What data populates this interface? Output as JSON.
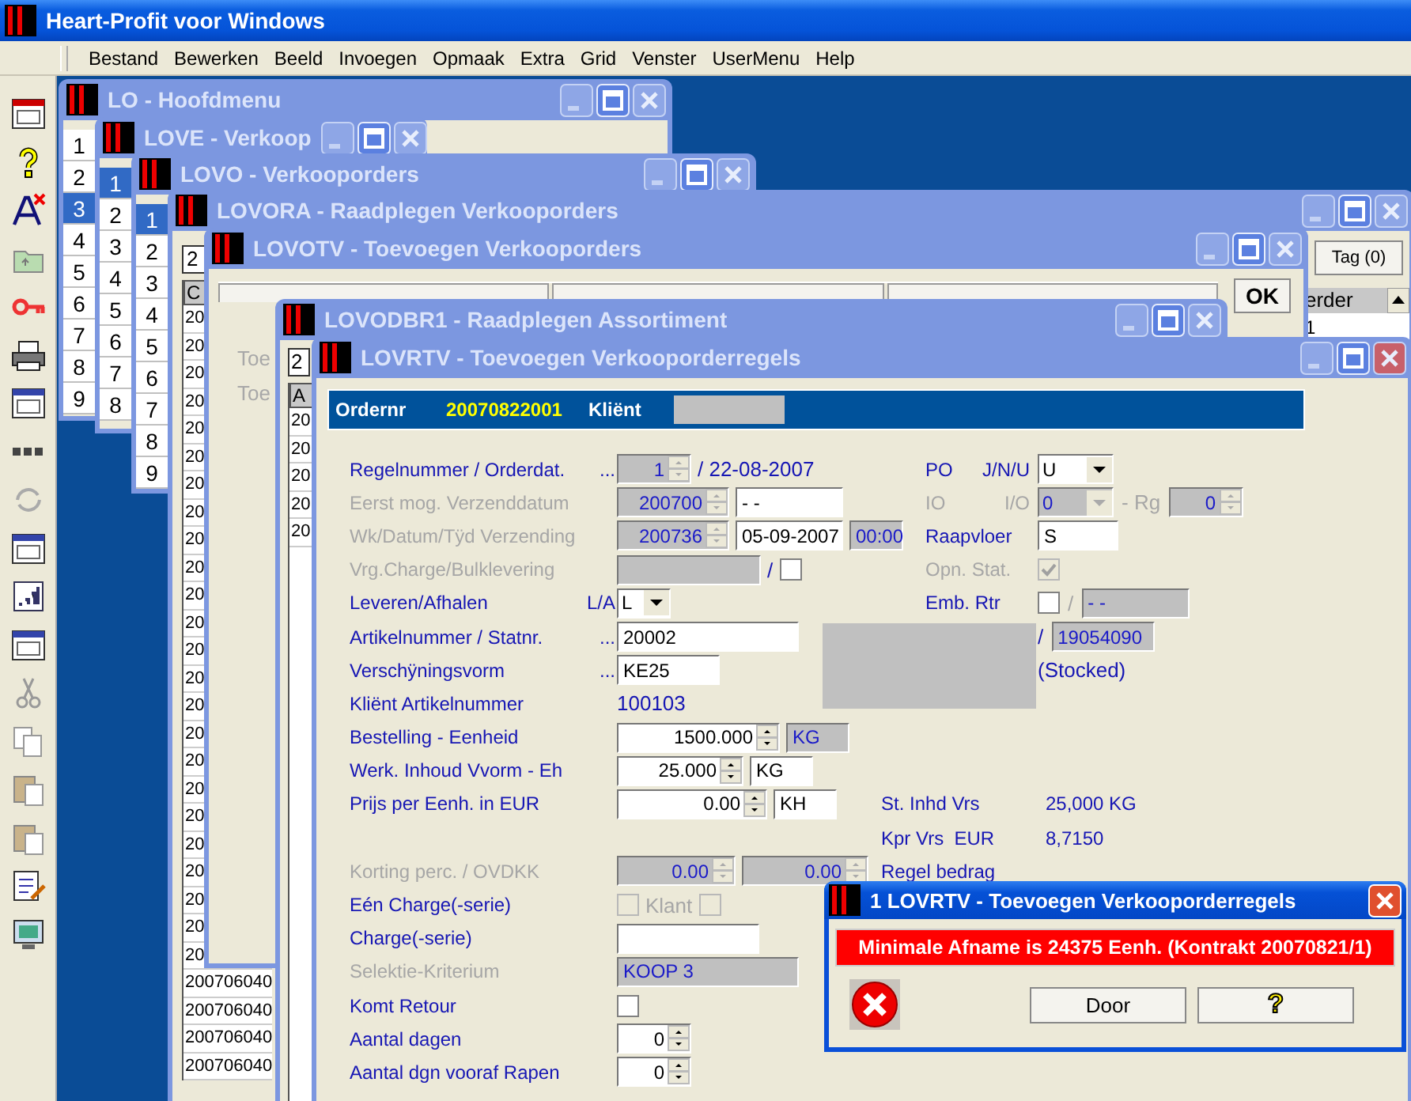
{
  "app": {
    "title": "Heart-Profit voor Windows"
  },
  "menu": [
    "Bestand",
    "Bewerken",
    "Beeld",
    "Invoegen",
    "Opmaak",
    "Extra",
    "Grid",
    "Venster",
    "UserMenu",
    "Help"
  ],
  "windows": [
    {
      "title": "LO - Hoofdmenu",
      "kind": "menu",
      "items": [
        {
          "label": "1",
          "selected": false
        },
        {
          "label": "2",
          "selected": false
        },
        {
          "label": "3",
          "selected": true
        },
        {
          "label": "4",
          "selected": false
        },
        {
          "label": "5",
          "selected": false
        },
        {
          "label": "6",
          "selected": false
        },
        {
          "label": "7",
          "selected": false
        },
        {
          "label": "8",
          "selected": false
        },
        {
          "label": "9",
          "selected": false
        }
      ]
    },
    {
      "title": "LOVE - Verkoop",
      "kind": "menu",
      "items": [
        {
          "label": "1",
          "selected": true
        },
        {
          "label": "2",
          "selected": false
        },
        {
          "label": "3",
          "selected": false
        },
        {
          "label": "4",
          "selected": false
        },
        {
          "label": "5",
          "selected": false
        },
        {
          "label": "6",
          "selected": false
        },
        {
          "label": "7",
          "selected": false
        },
        {
          "label": "8",
          "selected": false
        }
      ]
    },
    {
      "title": "LOVO - Verkooporders",
      "kind": "menu",
      "items": [
        {
          "label": "1",
          "selected": true
        },
        {
          "label": "2",
          "selected": false
        },
        {
          "label": "3",
          "selected": false
        },
        {
          "label": "4",
          "selected": false
        },
        {
          "label": "5",
          "selected": false
        },
        {
          "label": "6",
          "selected": false
        },
        {
          "label": "7",
          "selected": false
        },
        {
          "label": "8",
          "selected": false
        },
        {
          "label": "9",
          "selected": false
        }
      ]
    },
    {
      "title": "LOVORA - Raadplegen Verkooporders",
      "kind": "browse",
      "search_value": "2",
      "column_1": "C",
      "rows": [
        "20",
        "20",
        "20",
        "20",
        "20",
        "20",
        "20",
        "20",
        "20",
        "20",
        "20",
        "20",
        "20",
        "20",
        "20",
        "20",
        "20",
        "20",
        "20",
        "20",
        "20",
        "20",
        "20",
        "20",
        "200706040",
        "200706040",
        "200706040",
        "200706040"
      ],
      "tag_button": "Tag (0)",
      "column_2": "erder",
      "column_2_rows": [
        "1"
      ]
    },
    {
      "title": "LOVOTV - Toevoegen Verkooporders",
      "kind": "entry",
      "labels": [
        "Toe",
        "Toe"
      ],
      "ok_button": "OK"
    },
    {
      "title": "LOVODBR1 - Raadplegen Assortiment",
      "kind": "lookup",
      "search_value": "2",
      "column_1": "A",
      "rows": [
        "20",
        "20",
        "20",
        "20",
        "20"
      ]
    },
    {
      "title": "LOVRTV - Toevoegen Verkooporderregels",
      "kind": "form",
      "form": {
        "header": {
          "order_label": "Ordernr",
          "order_number": "20070822001",
          "client_label": "Kliënt"
        },
        "rows": [
          {
            "label": "Regelnummer / Orderdat.",
            "disabled": false,
            "prefix": "...",
            "controls": [
              {
                "kind": "spin",
                "value": "1",
                "disabled": true
              },
              {
                "kind": "plain",
                "value": "/ 22-08-2007",
                "disabled": false
              }
            ],
            "right": {
              "kind": "status",
              "label": "PO",
              "label_2": "J/N/U",
              "disabled": false,
              "controls": [
                {
                  "kind": "dropdown",
                  "value": "U",
                  "disabled": false
                }
              ]
            }
          },
          {
            "label": "Eerst mog. Verzenddatum",
            "disabled": true,
            "controls": [
              {
                "kind": "spin",
                "value": "200700",
                "disabled": true
              },
              {
                "kind": "text",
                "value": "- -"
              }
            ],
            "right": {
              "kind": "status",
              "label": "IO",
              "label_2": "I/O",
              "disabled": true,
              "controls": [
                {
                  "kind": "dropdown",
                  "value": "0",
                  "disabled": true
                },
                {
                  "kind": "plain",
                  "value": "- Rg",
                  "disabled": true
                },
                {
                  "kind": "spin",
                  "value": "0",
                  "disabled": true
                }
              ]
            }
          },
          {
            "label": "Wk/Datum/Tÿd Verzending",
            "disabled": true,
            "controls": [
              {
                "kind": "spin",
                "value": "200736",
                "disabled": true
              },
              {
                "kind": "text",
                "value": "05-09-2007"
              },
              {
                "kind": "readonly",
                "value": "00:00"
              }
            ],
            "right": {
              "kind": "status",
              "label": "Raapvloer",
              "disabled": false,
              "controls": [
                {
                  "kind": "text",
                  "value": "S"
                }
              ]
            }
          },
          {
            "label": "Vrg.Charge/Bulklevering",
            "disabled": true,
            "controls": [
              {
                "kind": "blank"
              },
              {
                "kind": "plain",
                "value": "/",
                "disabled": false
              },
              {
                "kind": "checkbox",
                "checked": false,
                "disabled": false
              }
            ],
            "right": {
              "kind": "status",
              "label": "Opn. Stat.",
              "disabled": true,
              "controls": [
                {
                  "kind": "checkbox",
                  "checked": true,
                  "disabled": true
                }
              ]
            }
          },
          {
            "label": "Leveren/Afhalen",
            "disabled": false,
            "prefix": "L/A",
            "controls": [
              {
                "kind": "dropdown",
                "value": "L",
                "disabled": false
              }
            ],
            "right": {
              "kind": "status",
              "label": "Emb. Rtr",
              "disabled": false,
              "controls": [
                {
                  "kind": "checkbox",
                  "checked": false,
                  "disabled": false
                },
                {
                  "kind": "plain",
                  "value": "/",
                  "disabled": true
                },
                {
                  "kind": "readonly",
                  "value": "- -"
                }
              ]
            }
          },
          {
            "label": "Artikelnummer / Statnr.",
            "disabled": false,
            "prefix": "...",
            "controls": [
              {
                "kind": "text",
                "value": "20002"
              }
            ],
            "right": {
              "kind": "status",
              "controls": [
                {
                  "kind": "plain",
                  "value": "/",
                  "disabled": false
                },
                {
                  "kind": "readonly",
                  "value": "19054090"
                }
              ]
            }
          },
          {
            "label": "Verschÿningsvorm",
            "disabled": false,
            "prefix": "...",
            "controls": [
              {
                "kind": "text",
                "value": "KE25"
              }
            ],
            "right": {
              "kind": "status",
              "controls": [
                {
                  "kind": "plain",
                  "value": "(Stocked)",
                  "disabled": false
                }
              ]
            }
          },
          {
            "label": "Kliënt Artikelnummer",
            "disabled": false,
            "controls": [
              {
                "kind": "plain",
                "value": "100103",
                "disabled": false
              }
            ]
          },
          {
            "label": "Bestelling - Eenheid",
            "disabled": false,
            "controls": [
              {
                "kind": "spin",
                "value": "1500.000",
                "disabled": false
              },
              {
                "kind": "readonly",
                "value": "KG"
              }
            ]
          },
          {
            "label": "Werk. Inhoud Vvorm - Eh",
            "disabled": false,
            "controls": [
              {
                "kind": "spin",
                "value": "25.000",
                "disabled": false
              },
              {
                "kind": "text",
                "value": "KG"
              }
            ]
          },
          {
            "label": "Prijs per Eenh. in EUR",
            "disabled": false,
            "controls": [
              {
                "kind": "spin",
                "value": "0.00",
                "disabled": false
              },
              {
                "kind": "text",
                "value": "KH"
              }
            ],
            "right": {
              "kind": "summary",
              "label": "St. Inhd Vrs",
              "value": "25,000 KG"
            }
          },
          {
            "controls": [],
            "right": {
              "kind": "summary",
              "label": "Kpr Vrs  EUR",
              "value": "8,7150"
            }
          },
          {
            "label": "Korting perc. / OVDKK",
            "disabled": true,
            "controls": [
              {
                "kind": "spin",
                "value": "0.00",
                "disabled": true
              },
              {
                "kind": "spin",
                "value": "0.00",
                "disabled": true
              }
            ],
            "right": {
              "kind": "summary",
              "label": "Regel bedrag"
            }
          },
          {
            "label": "Eén Charge(-serie)",
            "disabled": false,
            "controls": [
              {
                "kind": "checkbox",
                "checked": false,
                "disabled": true
              },
              {
                "kind": "plain",
                "value": "Klant",
                "disabled": true
              },
              {
                "kind": "checkbox",
                "checked": false,
                "disabled": true
              }
            ]
          },
          {
            "label": "Charge(-serie)",
            "disabled": false,
            "controls": [
              {
                "kind": "text"
              }
            ]
          },
          {
            "label": "Selektie-Kriterium",
            "disabled": true,
            "controls": [
              {
                "kind": "readonly",
                "value": "KOOP 3"
              }
            ]
          },
          {
            "label": "Komt Retour",
            "disabled": false,
            "controls": [
              {
                "kind": "checkbox",
                "checked": false,
                "disabled": false
              }
            ]
          },
          {
            "label": "Aantal dagen",
            "disabled": false,
            "controls": [
              {
                "kind": "spin",
                "value": "0",
                "disabled": false
              }
            ]
          },
          {
            "label": "Aantal dgn vooraf Rapen",
            "disabled": false,
            "controls": [
              {
                "kind": "spin",
                "value": "0",
                "disabled": false
              }
            ]
          }
        ]
      }
    }
  ],
  "dialog": {
    "title": "1 LOVRTV - Toevoegen Verkooporderregels",
    "message": "Minimale Afname is 24375 Eenh. (Kontrakt 20070821/1)",
    "buttons": [
      "Door",
      "?"
    ]
  }
}
